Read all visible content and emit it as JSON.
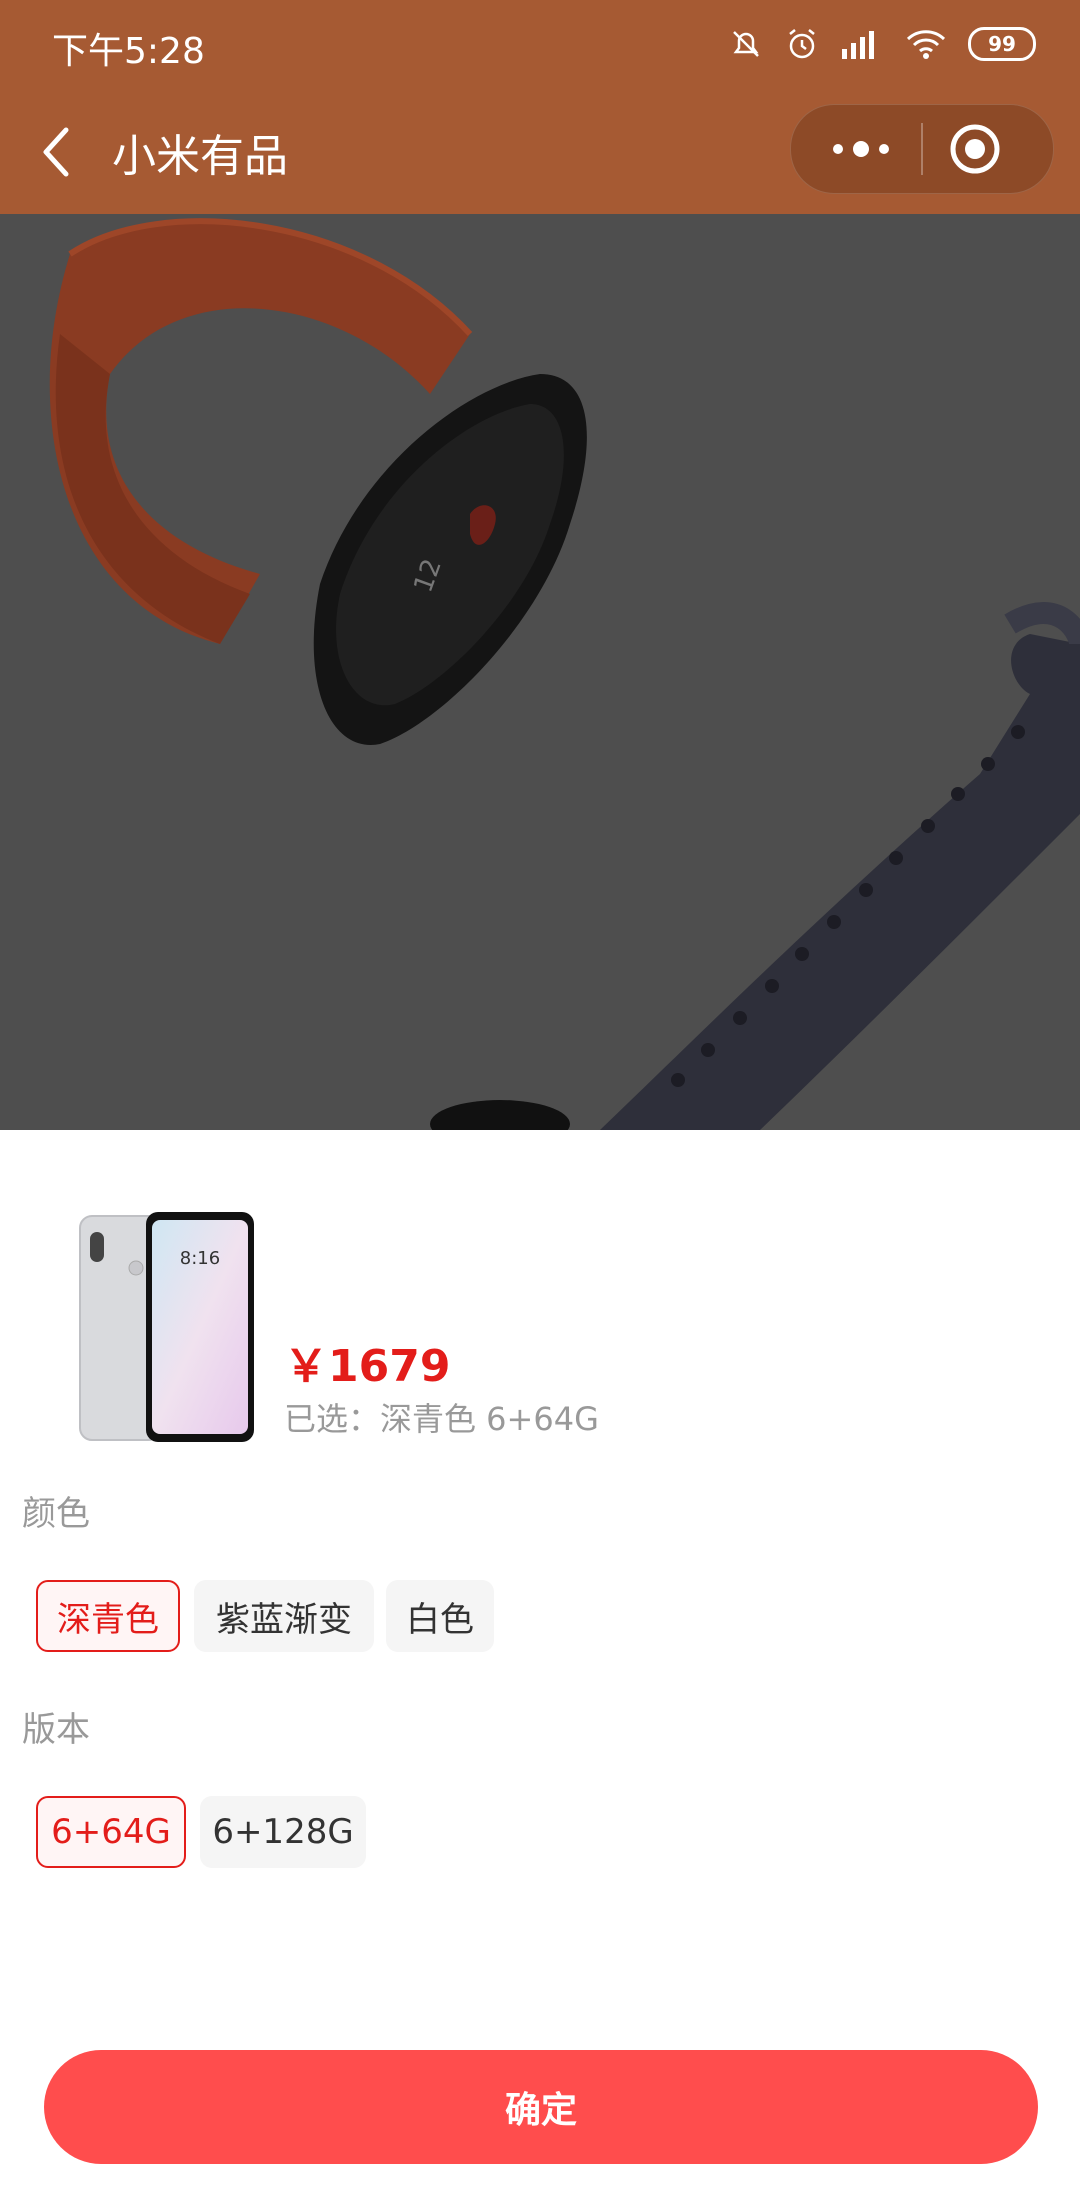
{
  "status": {
    "time": "下午5:28",
    "battery": "99"
  },
  "nav": {
    "title": "小米有品"
  },
  "product": {
    "price": "￥1679",
    "selected_text": "已选：深青色 6+64G",
    "thumb_time": "8:16"
  },
  "color_section": {
    "label": "颜色",
    "options": [
      "深青色",
      "紫蓝渐变",
      "白色"
    ],
    "selected_index": 0
  },
  "version_section": {
    "label": "版本",
    "options": [
      "6+64G",
      "6+128G"
    ],
    "selected_index": 0
  },
  "confirm_label": "确定",
  "colors": {
    "header_bg": "#A65A33",
    "accent_red": "#E31D1A",
    "button_red": "#FF4D4D"
  }
}
